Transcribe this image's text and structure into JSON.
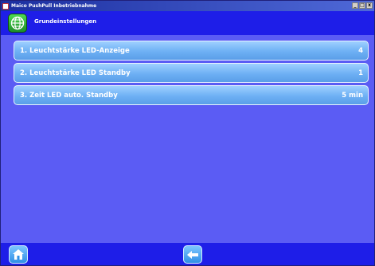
{
  "window": {
    "title": "Maico PushPull Inbetriebnahme",
    "buttons": {
      "minimize": "_",
      "maximize": "□",
      "close": "x"
    }
  },
  "header": {
    "title": "Grundeinstellungen",
    "icon": "globe-icon"
  },
  "settings": [
    {
      "label": "1. Leuchtstärke LED-Anzeige",
      "value": "4"
    },
    {
      "label": "2. Leuchtstärke LED Standby",
      "value": "1"
    },
    {
      "label": "3. Zeit LED auto. Standby",
      "value": "5 min"
    }
  ],
  "footer": {
    "home_icon": "home-icon",
    "back_icon": "back-arrow-icon"
  },
  "colors": {
    "background": "#5b5cf4",
    "header": "#1e1ee8",
    "row": "#6eb0f4"
  }
}
